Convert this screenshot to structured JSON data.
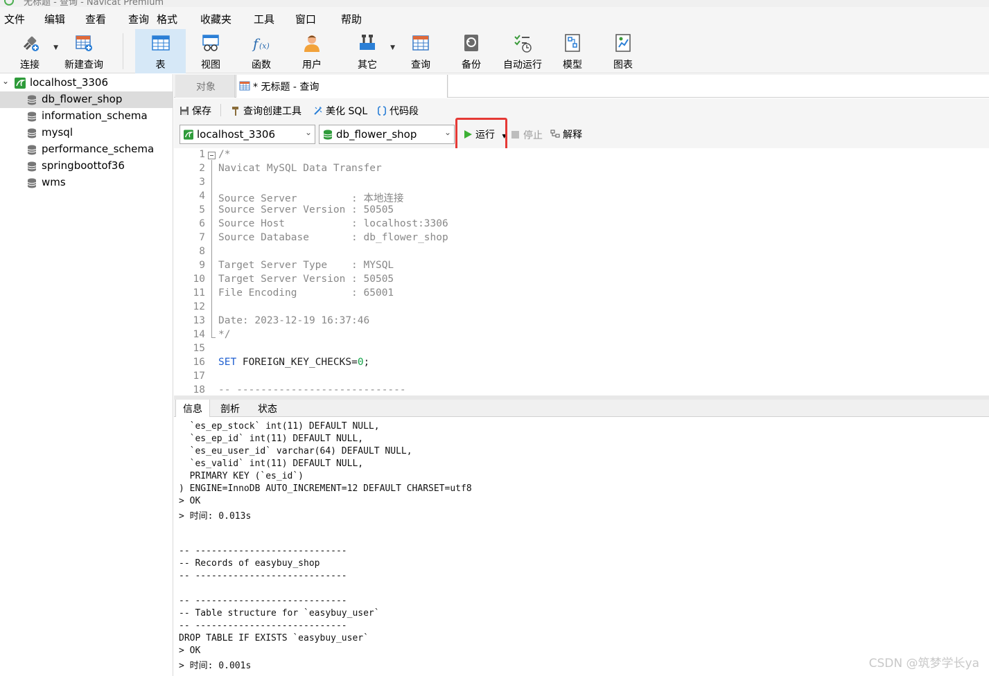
{
  "window": {
    "title": "无标题 - 查询 - Navicat Premium"
  },
  "menu": [
    "文件",
    "编辑",
    "查看",
    "查询",
    "格式",
    "收藏夹",
    "工具",
    "窗口",
    "帮助"
  ],
  "toolbar": {
    "items": [
      {
        "label": "连接",
        "icon": "plug-icon"
      },
      {
        "label": "新建查询",
        "icon": "new-query-icon"
      },
      {
        "label": "表",
        "icon": "table-icon"
      },
      {
        "label": "视图",
        "icon": "view-icon"
      },
      {
        "label": "函数",
        "icon": "function-icon"
      },
      {
        "label": "用户",
        "icon": "user-icon"
      },
      {
        "label": "其它",
        "icon": "tools-icon"
      },
      {
        "label": "查询",
        "icon": "query-icon"
      },
      {
        "label": "备份",
        "icon": "backup-icon"
      },
      {
        "label": "自动运行",
        "icon": "autorun-icon"
      },
      {
        "label": "模型",
        "icon": "model-icon"
      },
      {
        "label": "图表",
        "icon": "chart-icon"
      }
    ]
  },
  "tree": {
    "connection": "localhost_3306",
    "databases": [
      "db_flower_shop",
      "information_schema",
      "mysql",
      "performance_schema",
      "springboottof36",
      "wms"
    ],
    "selected": "db_flower_shop"
  },
  "tabs": {
    "objects": "对象",
    "query": "* 无标题 - 查询"
  },
  "query_toolbar": {
    "save": "保存",
    "builder": "查询创建工具",
    "beautify": "美化 SQL",
    "snippet": "代码段",
    "connection": "localhost_3306",
    "database": "db_flower_shop",
    "run": "运行",
    "stop": "停止",
    "explain": "解释"
  },
  "editor": {
    "lines": [
      {
        "n": "1",
        "text": "/*"
      },
      {
        "n": "2",
        "text": "Navicat MySQL Data Transfer"
      },
      {
        "n": "3",
        "text": ""
      },
      {
        "n": "4",
        "text": "Source Server         : 本地连接"
      },
      {
        "n": "5",
        "text": "Source Server Version : 50505"
      },
      {
        "n": "6",
        "text": "Source Host           : localhost:3306"
      },
      {
        "n": "7",
        "text": "Source Database       : db_flower_shop"
      },
      {
        "n": "8",
        "text": ""
      },
      {
        "n": "9",
        "text": "Target Server Type    : MYSQL"
      },
      {
        "n": "10",
        "text": "Target Server Version : 50505"
      },
      {
        "n": "11",
        "text": "File Encoding         : 65001"
      },
      {
        "n": "12",
        "text": ""
      },
      {
        "n": "13",
        "text": "Date: 2023-12-19 16:37:46"
      },
      {
        "n": "14",
        "text": "*/"
      },
      {
        "n": "15",
        "text": ""
      },
      {
        "n": "16",
        "kw": "SET",
        "rest": " FOREIGN_KEY_CHECKS=",
        "val": "0",
        "tail": ";"
      },
      {
        "n": "17",
        "text": ""
      },
      {
        "n": "18",
        "text": "-- ----------------------------"
      }
    ]
  },
  "result_tabs": [
    "信息",
    "剖析",
    "状态"
  ],
  "output": {
    "lines": [
      "  `es_ep_stock` int(11) DEFAULT NULL,",
      "  `es_ep_id` int(11) DEFAULT NULL,",
      "  `es_eu_user_id` varchar(64) DEFAULT NULL,",
      "  `es_valid` int(11) DEFAULT NULL,",
      "  PRIMARY KEY (`es_id`)",
      ") ENGINE=InnoDB AUTO_INCREMENT=12 DEFAULT CHARSET=utf8",
      "> OK",
      "> 时间: 0.013s",
      "",
      "",
      "-- ----------------------------",
      "-- Records of easybuy_shop",
      "-- ----------------------------",
      "",
      "-- ----------------------------",
      "-- Table structure for `easybuy_user`",
      "-- ----------------------------",
      "DROP TABLE IF EXISTS `easybuy_user`",
      "> OK",
      "> 时间: 0.001s"
    ]
  },
  "watermark": "CSDN @筑梦学长ya",
  "colors": {
    "run_highlight": "#e53935",
    "selected_tool": "#d6e8f7",
    "keyword": "#1f5fd0",
    "number": "#16a34a"
  }
}
